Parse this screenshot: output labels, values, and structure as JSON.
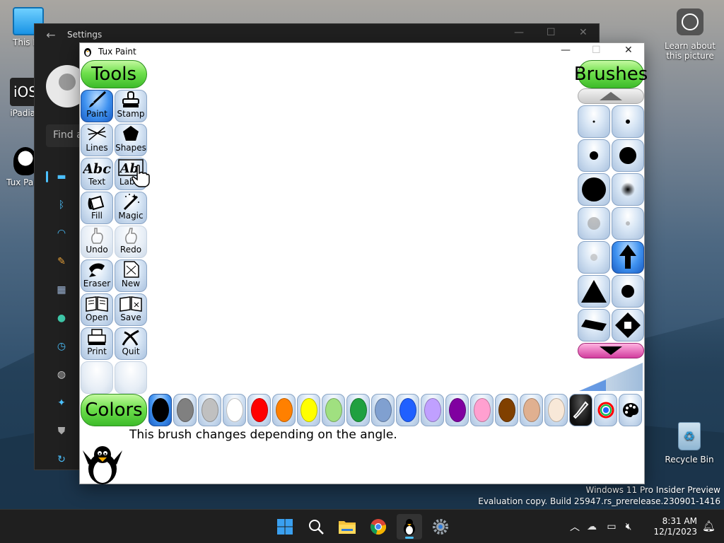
{
  "desktop": {
    "icons": {
      "this_pc": "This PC",
      "ipadian": "iPadian",
      "tux_paint": "Tux Paint",
      "learn": "Learn about this picture",
      "recycle_bin": "Recycle Bin"
    },
    "watermark": {
      "line1": "Windows 11 Pro Insider Preview",
      "line2": "Evaluation copy. Build 25947.rs_prerelease.230901-1416"
    }
  },
  "settings_window": {
    "title": "Settings",
    "search_placeholder": "Find a",
    "nav_icons": [
      "system-icon",
      "bluetooth-icon",
      "network-icon",
      "personalization-icon",
      "apps-icon",
      "accounts-icon",
      "time-language-icon",
      "gaming-icon",
      "accessibility-icon",
      "privacy-icon",
      "windows-update-icon"
    ]
  },
  "tuxpaint": {
    "title": "Tux Paint",
    "tools_header": "Tools",
    "brushes_header": "Brushes",
    "colors_header": "Colors",
    "tools": [
      {
        "label": "Paint",
        "selected": true
      },
      {
        "label": "Stamp"
      },
      {
        "label": "Lines"
      },
      {
        "label": "Shapes"
      },
      {
        "label": "Text"
      },
      {
        "label": "Label"
      },
      {
        "label": "Fill"
      },
      {
        "label": "Magic"
      },
      {
        "label": "Undo"
      },
      {
        "label": "Redo"
      },
      {
        "label": "Eraser"
      },
      {
        "label": "New"
      },
      {
        "label": "Open"
      },
      {
        "label": "Save"
      },
      {
        "label": "Print"
      },
      {
        "label": "Quit"
      }
    ],
    "colors": [
      "#000000",
      "#808080",
      "#c0c0c0",
      "#ffffff",
      "#ff0000",
      "#ff8000",
      "#ffff00",
      "#a0e080",
      "#20a040",
      "#80a0d0",
      "#2060ff",
      "#c0a0ff",
      "#8000a0",
      "#ffa0d0",
      "#804000",
      "#e0b090",
      "#f8e8d8"
    ],
    "status_message": "This brush changes depending on the angle."
  },
  "taskbar": {
    "apps": [
      "start",
      "search",
      "file-explorer",
      "chrome",
      "tux-paint",
      "settings"
    ],
    "time": "8:31 AM",
    "date": "12/1/2023"
  }
}
